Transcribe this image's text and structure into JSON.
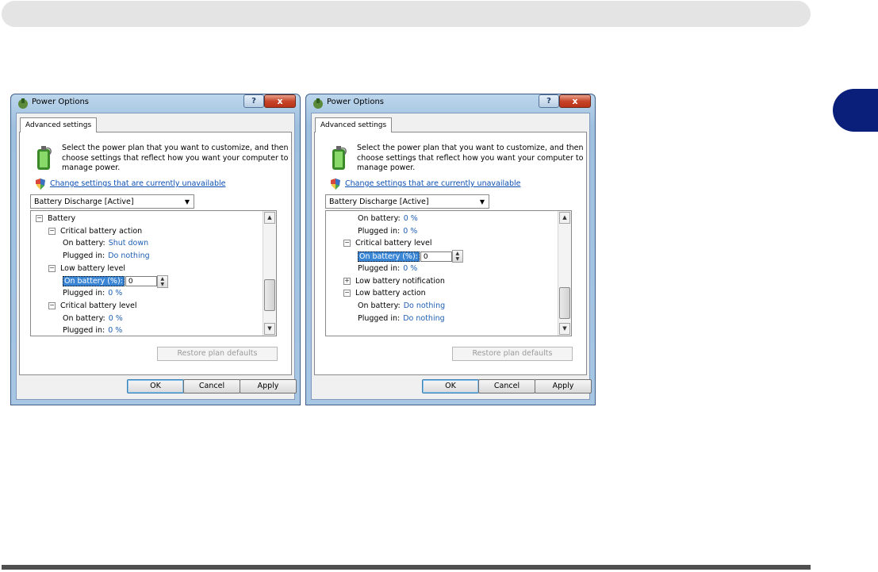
{
  "dialogs": [
    {
      "title": "Power Options",
      "help_glyph": "?",
      "close_glyph": "x",
      "tab": "Advanced settings",
      "intro": "Select the power plan that you want to customize, and then choose settings that reflect how you want your computer to manage power.",
      "change_link": "Change settings that are currently unavailable",
      "plan": "Battery Discharge [Active]",
      "restore": "Restore plan defaults",
      "ok": "OK",
      "cancel": "Cancel",
      "apply": "Apply",
      "tree": [
        {
          "indent": 0,
          "expander": "−",
          "label": "Battery"
        },
        {
          "indent": 1,
          "expander": "−",
          "label": "Critical battery action"
        },
        {
          "indent": 2,
          "label": "On battery:",
          "value": "Shut down"
        },
        {
          "indent": 2,
          "label": "Plugged in:",
          "value": "Do nothing"
        },
        {
          "indent": 1,
          "expander": "−",
          "label": "Low battery level"
        },
        {
          "indent": 2,
          "label": "On battery (%):",
          "spin": "0",
          "highlight": true
        },
        {
          "indent": 2,
          "label": "Plugged in:",
          "value": "0 %"
        },
        {
          "indent": 1,
          "expander": "−",
          "label": "Critical battery level"
        },
        {
          "indent": 2,
          "label": "On battery:",
          "value": "0 %"
        },
        {
          "indent": 2,
          "label": "Plugged in:",
          "value": "0 %"
        }
      ]
    },
    {
      "title": "Power Options",
      "help_glyph": "?",
      "close_glyph": "x",
      "tab": "Advanced settings",
      "intro": "Select the power plan that you want to customize, and then choose settings that reflect how you want your computer to manage power.",
      "change_link": "Change settings that are currently unavailable",
      "plan": "Battery Discharge [Active]",
      "restore": "Restore plan defaults",
      "ok": "OK",
      "cancel": "Cancel",
      "apply": "Apply",
      "tree": [
        {
          "indent": 2,
          "label": "On battery:",
          "value": "0 %"
        },
        {
          "indent": 2,
          "label": "Plugged in:",
          "value": "0 %"
        },
        {
          "indent": 1,
          "expander": "−",
          "label": "Critical battery level"
        },
        {
          "indent": 2,
          "label": "On battery (%):",
          "spin": "0",
          "highlight": true
        },
        {
          "indent": 2,
          "label": "Plugged in:",
          "value": "0 %"
        },
        {
          "indent": 1,
          "expander": "+",
          "label": "Low battery notification"
        },
        {
          "indent": 1,
          "expander": "−",
          "label": "Low battery action"
        },
        {
          "indent": 2,
          "label": "On battery:",
          "value": "Do nothing"
        },
        {
          "indent": 2,
          "label": "Plugged in:",
          "value": "Do nothing"
        }
      ]
    }
  ],
  "scrollbars": [
    {
      "position": 0.8
    },
    {
      "position": 0.92
    }
  ]
}
